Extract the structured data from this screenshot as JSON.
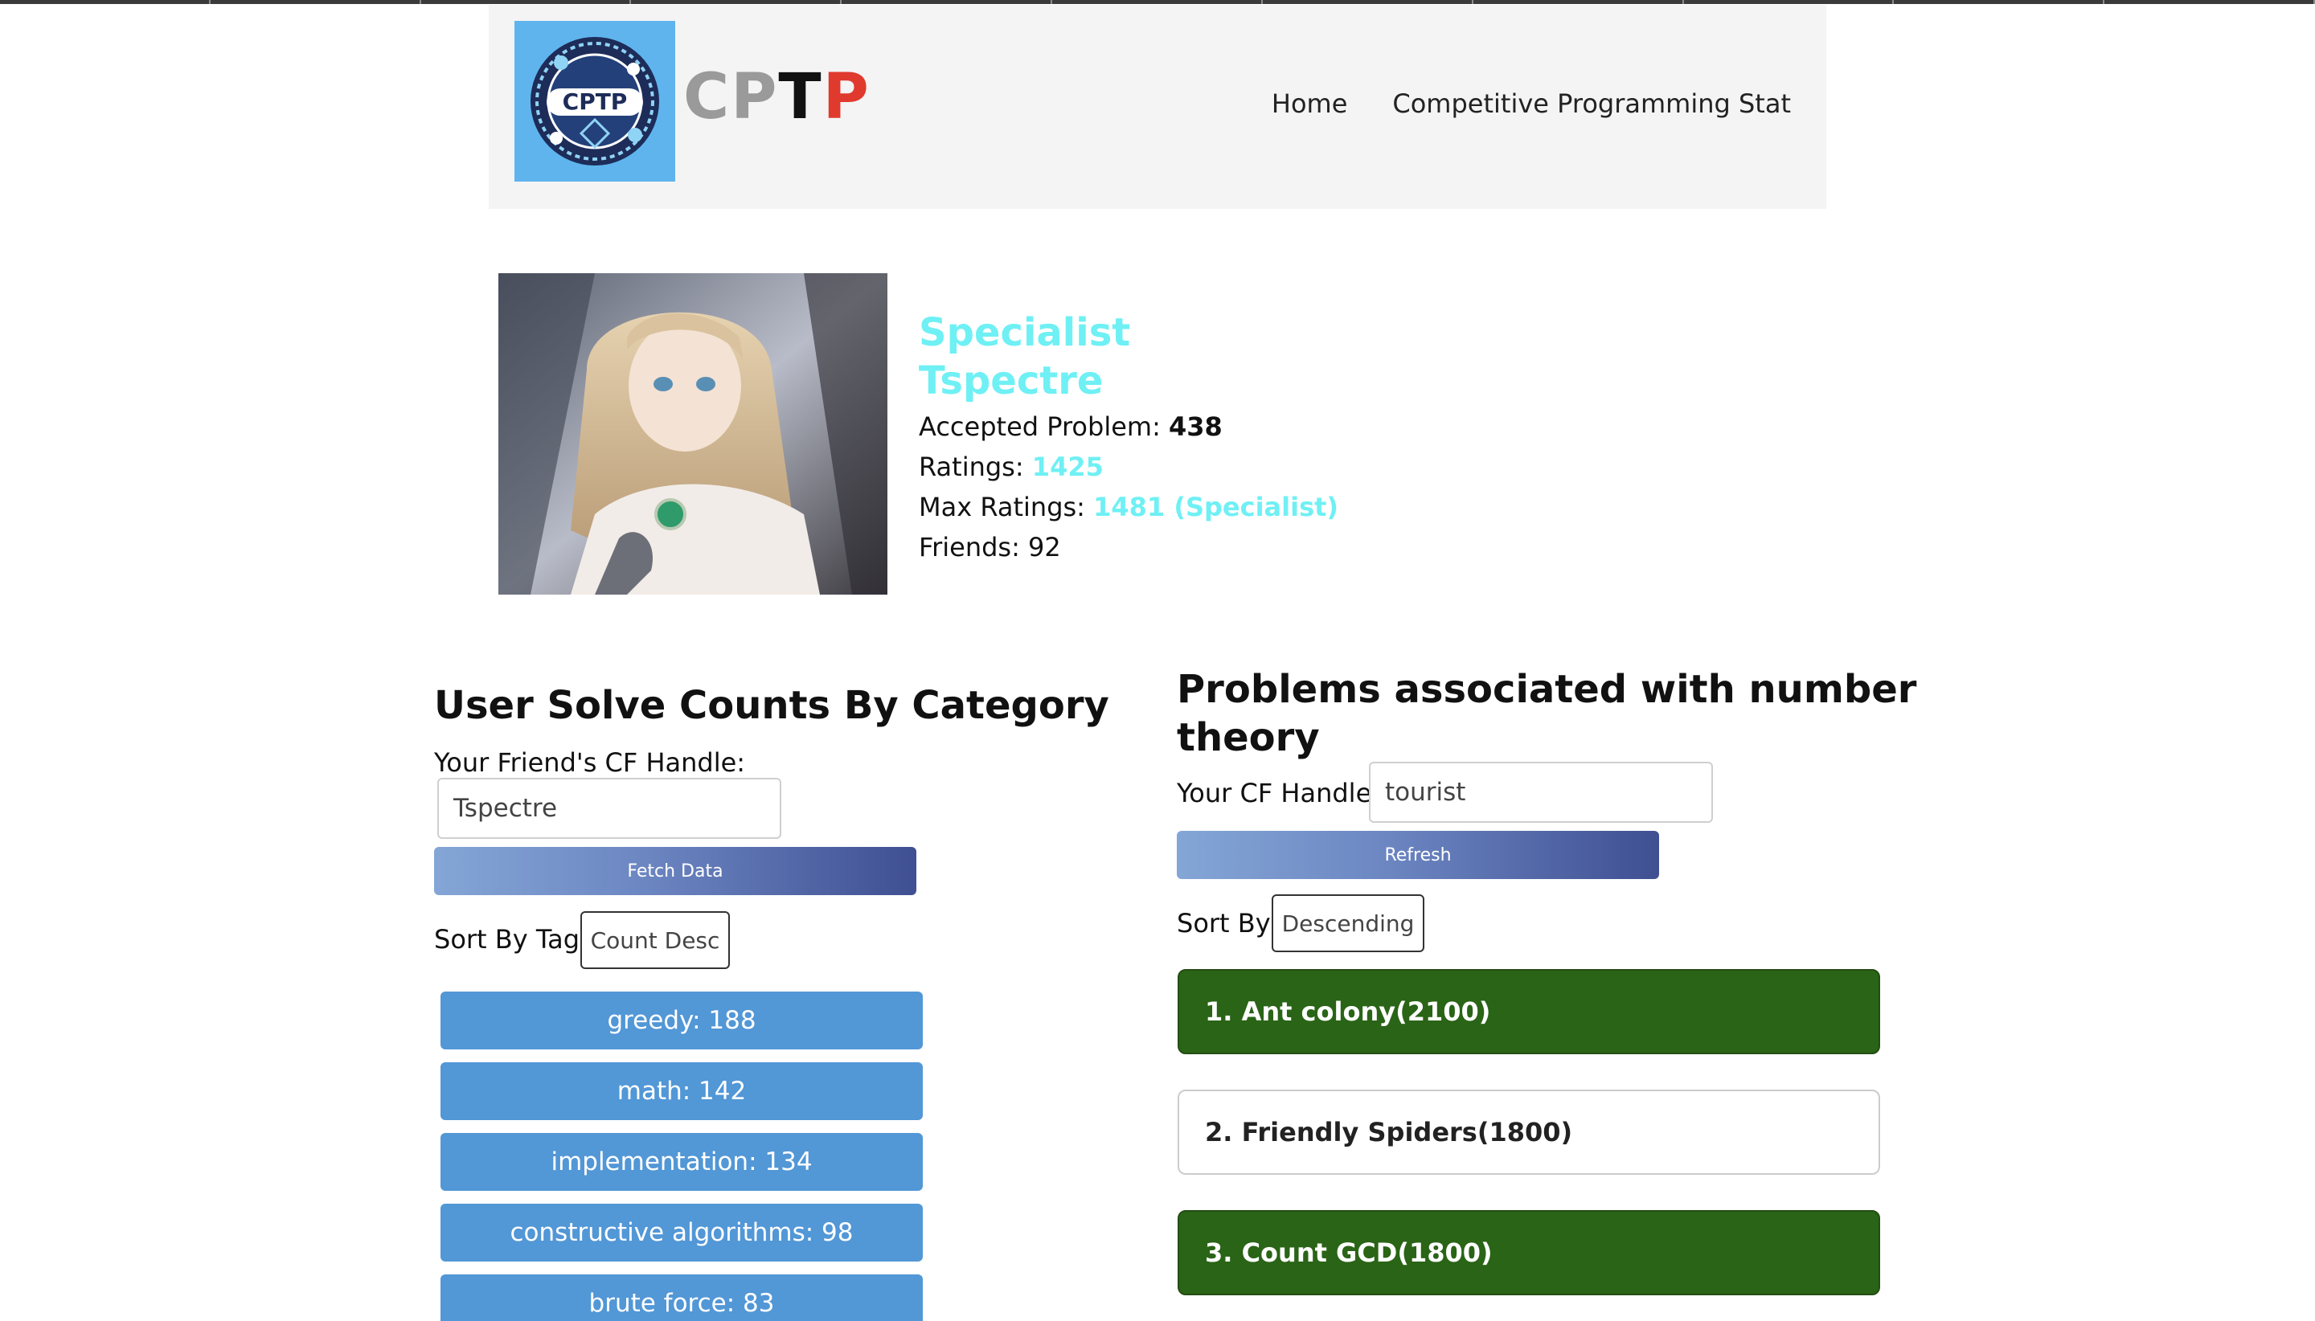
{
  "brand": {
    "part1": "CP",
    "part2": "T",
    "part3": "P",
    "logo_text": "CPTP"
  },
  "nav": {
    "home": "Home",
    "stat": "Competitive Programming Stat"
  },
  "profile": {
    "rank": "Specialist",
    "handle": "Tspectre",
    "accepted_label": "Accepted Problem: ",
    "accepted_value": "438",
    "ratings_label": "Ratings: ",
    "ratings_value": "1425",
    "max_label": "Max Ratings: ",
    "max_value": "1481 (Specialist)",
    "friends": "Friends: 92"
  },
  "left": {
    "title": "User Solve Counts By Category",
    "handle_label": "Your Friend's CF Handle:",
    "handle_value": "Tspectre",
    "fetch_button": "Fetch Data",
    "sort_label": "Sort By Tag:",
    "sort_value": "Count Desc",
    "tags": [
      "greedy: 188",
      "math: 142",
      "implementation: 134",
      "constructive algorithms: 98",
      "brute force: 83"
    ]
  },
  "right": {
    "title_line1": "Problems associated with number",
    "title_line2": "theory",
    "handle_label": "Your CF Handle:",
    "handle_value": "tourist",
    "refresh_button": "Refresh",
    "sort_label": "Sort By:",
    "sort_value": "Descending",
    "problems": [
      "1. Ant colony(2100)",
      "2. Friendly Spiders(1800)",
      "3. Count GCD(1800)"
    ]
  },
  "colors": {
    "rank_cyan": "#6ff0f4",
    "tag_blue": "#5297d6",
    "solved_green": "#2a6416",
    "brand_gray": "#9a9a9a",
    "brand_red": "#e03a2e"
  }
}
